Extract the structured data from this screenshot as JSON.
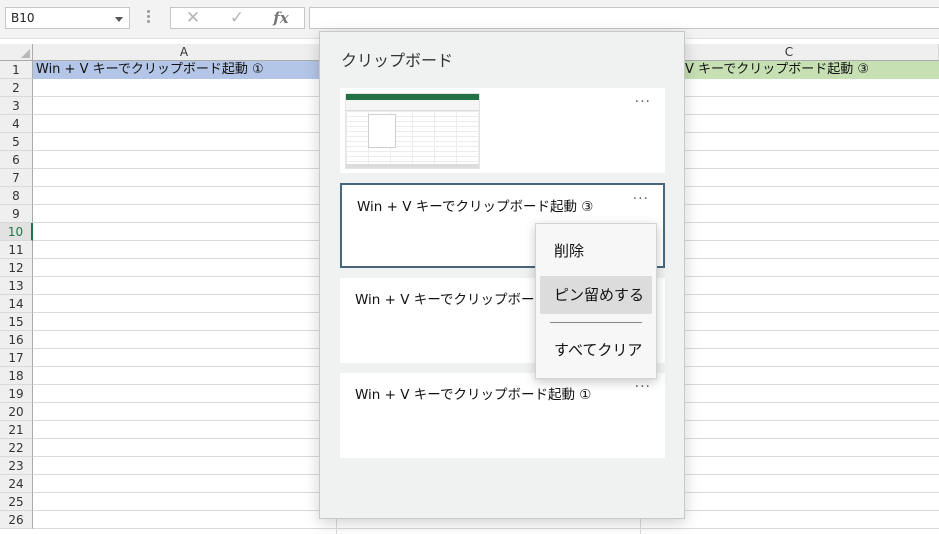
{
  "formula_bar": {
    "name_box": "B10",
    "cancel_icon": "✕",
    "enter_icon": "✓",
    "fx_label": "fx",
    "formula_value": ""
  },
  "grid": {
    "columns": [
      "A",
      "C"
    ],
    "rows": [
      "1",
      "2",
      "3",
      "4",
      "5",
      "6",
      "7",
      "8",
      "9",
      "10",
      "11",
      "12",
      "13",
      "14",
      "15",
      "16",
      "17",
      "18",
      "19",
      "20",
      "21",
      "22",
      "23",
      "24",
      "25",
      "26"
    ],
    "active_row": "10",
    "cells": {
      "A1": "Win + V キーでクリップボード起動 ①",
      "C1": "V キーでクリップボード起動 ③"
    },
    "colors": {
      "A1_fill": "#b4c6e7",
      "C1_fill": "#c6e0b4",
      "active": "#217346"
    }
  },
  "clipboard": {
    "title": "クリップボード",
    "items": [
      {
        "type": "image",
        "more": "···"
      },
      {
        "type": "text",
        "text": "Win + V キーでクリップボード起動 ③",
        "more": "···",
        "selected": true
      },
      {
        "type": "text",
        "text": "Win + V キーでクリップボード起",
        "more": "···"
      },
      {
        "type": "text",
        "text": "Win + V キーでクリップボード起動 ①",
        "more": "···"
      }
    ]
  },
  "context_menu": {
    "items": [
      "削除",
      "ピン留めする",
      "すべてクリア"
    ],
    "highlighted": "ピン留めする"
  }
}
